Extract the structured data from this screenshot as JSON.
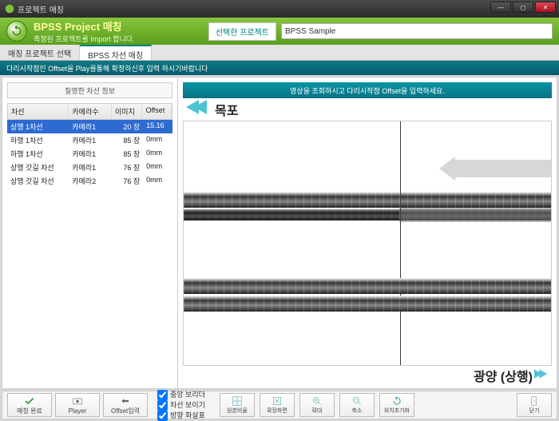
{
  "window": {
    "title": "프로젝트 매칭"
  },
  "ribbon": {
    "title": "BPSS Project 매칭",
    "subtitle": "측정된 프로젝트를 Import 합니다.",
    "select_btn": "선택한 프로젝트"
  },
  "project_input": {
    "value": "BPSS Sample"
  },
  "tabs": [
    {
      "label": "매칭 프로젝트 선택",
      "active": false
    },
    {
      "label": "BPSS 차선 매칭",
      "active": true
    }
  ],
  "infobar": "다리시작점인 Offset을 Play를통해 확정하신후 입력 하시기바랍니다",
  "left_panel": {
    "header": "칠영한 차선 정보",
    "columns": [
      "차선",
      "카메라수",
      "이미지",
      "Offset"
    ],
    "rows": [
      {
        "lane": "상행 1차선",
        "camera": "카메라1",
        "img": "20 장",
        "offset": "15.16",
        "sel": true
      },
      {
        "lane": "하행 1차선",
        "camera": "카메라1",
        "img": "85 장",
        "offset": "0mm"
      },
      {
        "lane": "하행 1차선",
        "camera": "카메라1",
        "img": "85 장",
        "offset": "0mm"
      },
      {
        "lane": "상행 갓길 차선",
        "camera": "카메라1",
        "img": "76 장",
        "offset": "0mm"
      },
      {
        "lane": "상행 갓길 차선",
        "camera": "카메라2",
        "img": "76 장",
        "offset": "0mm"
      }
    ]
  },
  "right_panel": {
    "topbar": "영상을 조회하시고 다리시작점 Offset을 입력하세요.",
    "start_label": "목포",
    "end_label": "광양 (상행)"
  },
  "footer": {
    "complete": "매칭 완료",
    "player": "Player",
    "offset_input": "Offset입력",
    "checks": {
      "c1": "중앙 보리더",
      "c2": "차선 보이기",
      "c3": "방향 화살표"
    },
    "iconbtns": [
      "원본비율",
      "확장화면",
      "확대",
      "축소",
      "위치초기화"
    ],
    "close": "닫기"
  }
}
